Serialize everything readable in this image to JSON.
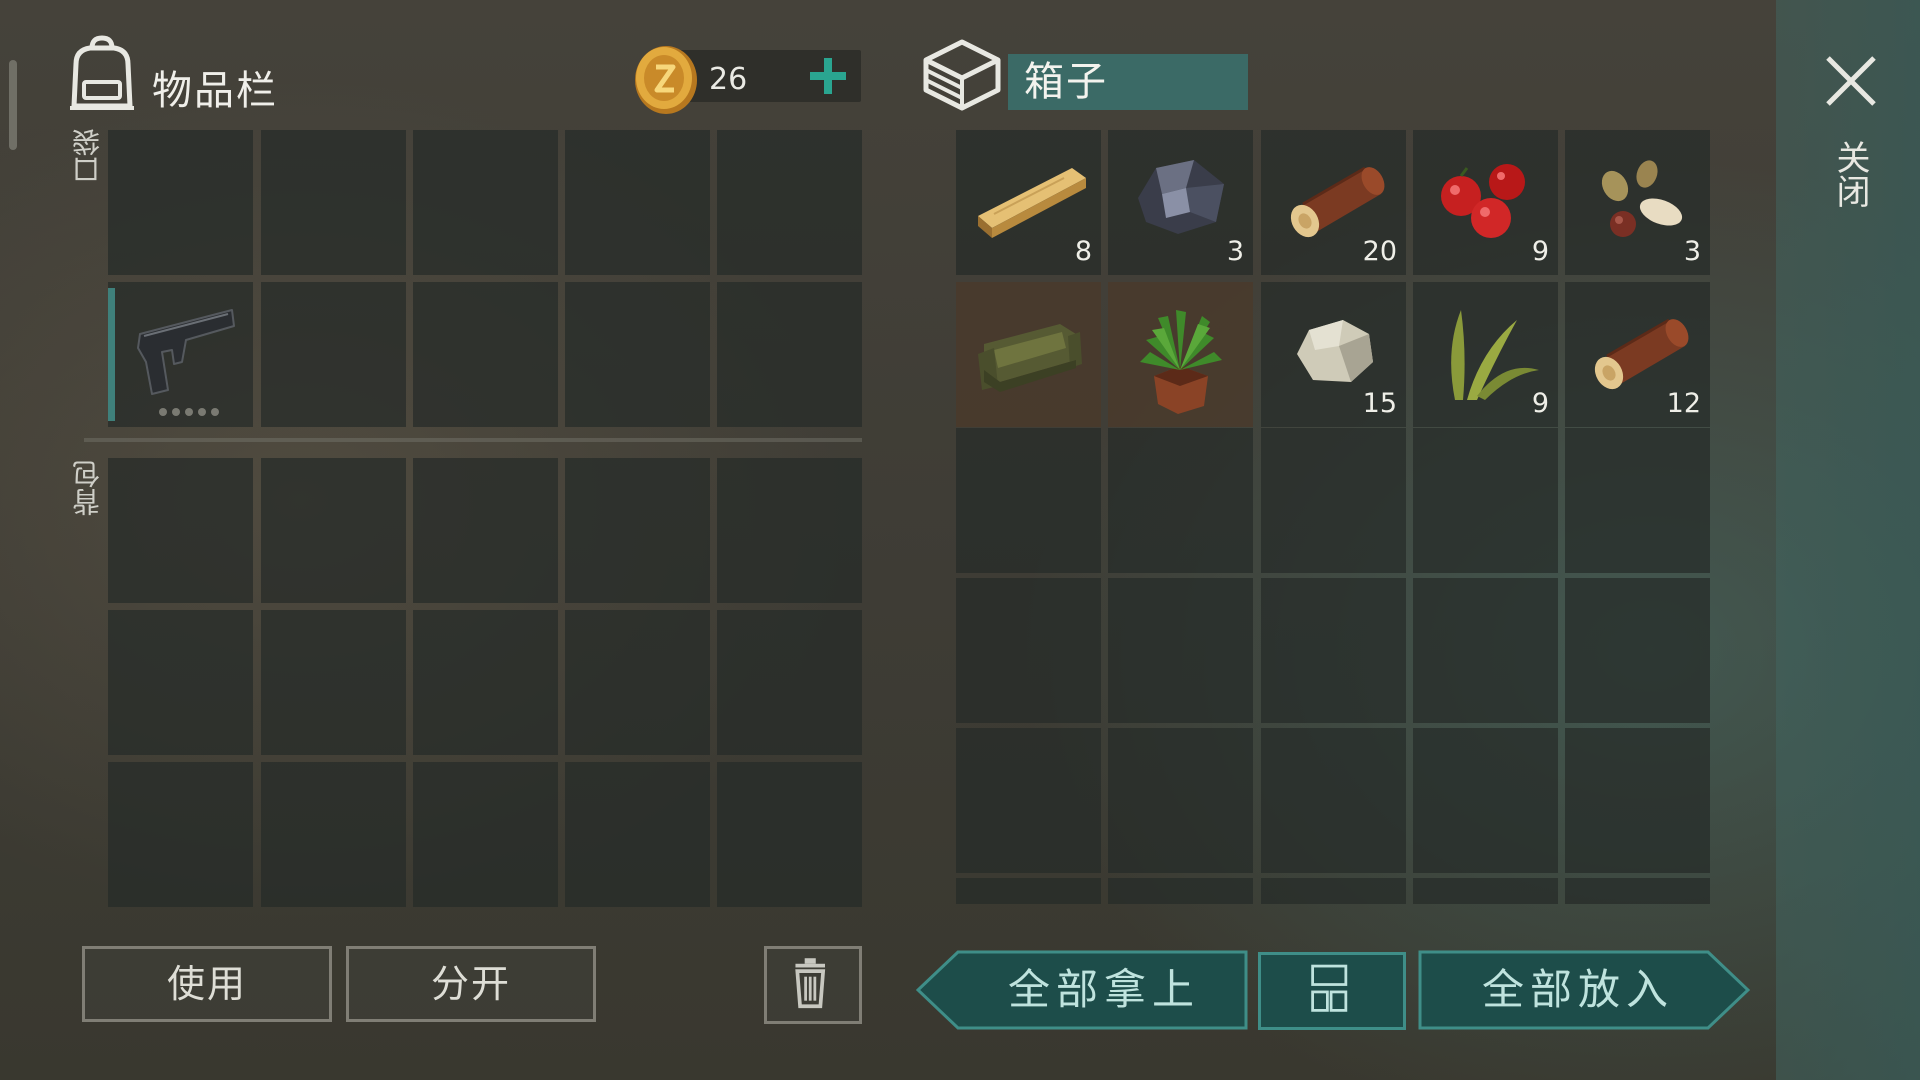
{
  "inventory": {
    "title": "物品栏",
    "coins": "26",
    "pocket_label": "口袋",
    "backpack_label": "背包",
    "pocket_items": [
      {
        "row": 1,
        "col": 0,
        "item": "pistol",
        "icon": "pistol-icon",
        "durability_dots": 5
      }
    ]
  },
  "container": {
    "title": "箱子",
    "items": [
      {
        "item": "wood-plank",
        "icon": "wood-plank-icon",
        "qty": "8"
      },
      {
        "item": "iron-ore",
        "icon": "iron-ore-icon",
        "qty": "3"
      },
      {
        "item": "log",
        "icon": "log-icon",
        "qty": "20"
      },
      {
        "item": "berries",
        "icon": "berries-icon",
        "qty": "9"
      },
      {
        "item": "seeds",
        "icon": "seeds-icon",
        "qty": "3"
      },
      {
        "item": "sofa",
        "icon": "sofa-icon",
        "qty": ""
      },
      {
        "item": "potted-plant",
        "icon": "potted-plant-icon",
        "qty": ""
      },
      {
        "item": "stone",
        "icon": "stone-icon",
        "qty": "15"
      },
      {
        "item": "plant-fiber",
        "icon": "plant-fiber-icon",
        "qty": "9"
      },
      {
        "item": "log",
        "icon": "log-icon",
        "qty": "12"
      }
    ]
  },
  "buttons": {
    "use": "使用",
    "split": "分开",
    "take_all": "全部拿上",
    "put_all": "全部放入"
  },
  "close_label": "关闭",
  "colors": {
    "accent_teal": "#3b6a66",
    "button_teal": "#1d4d4a",
    "plus_green": "#2aa590",
    "coin_gold": "#d9a23a"
  }
}
